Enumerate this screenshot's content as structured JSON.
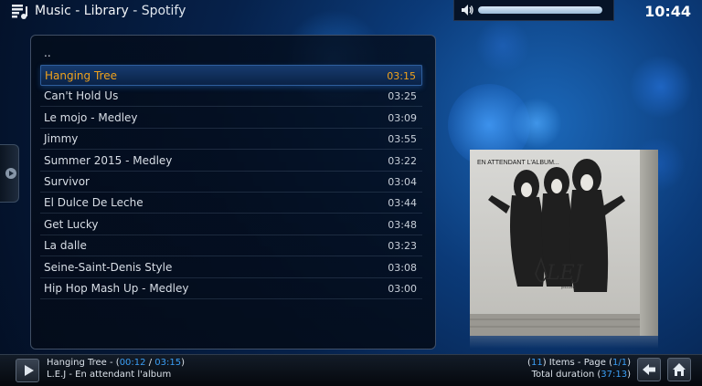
{
  "header": {
    "title": "Music - Library",
    "subtitle": " - Spotify",
    "clock": "10:44",
    "volume_level": 1.0
  },
  "list": {
    "parent_label": "..",
    "items": [
      {
        "name": "Hanging Tree",
        "duration": "03:15",
        "selected": true
      },
      {
        "name": "Can't Hold Us",
        "duration": "03:25"
      },
      {
        "name": "Le mojo - Medley",
        "duration": "03:09"
      },
      {
        "name": "Jimmy",
        "duration": "03:55"
      },
      {
        "name": "Summer 2015 - Medley",
        "duration": "03:22"
      },
      {
        "name": "Survivor",
        "duration": "03:04"
      },
      {
        "name": "El Dulce De Leche",
        "duration": "03:44"
      },
      {
        "name": "Get Lucky",
        "duration": "03:48"
      },
      {
        "name": "La dalle",
        "duration": "03:23"
      },
      {
        "name": "Seine-Saint-Denis Style",
        "duration": "03:08"
      },
      {
        "name": "Hip Hop Mash Up - Medley",
        "duration": "03:00"
      }
    ]
  },
  "album_art": {
    "caption": "EN ATTENDANT L'ALBUM...",
    "logo_text": "LEJ",
    "small_text": "(ELIJAY)"
  },
  "now_playing": {
    "track": "Hanging Tree - ",
    "elapsed": "00:12",
    "separator": " / ",
    "total": "03:15",
    "artist_album": "L.E.J - En attendant l'album"
  },
  "list_info": {
    "items_count": "11",
    "items_label": ") Items - Page (",
    "page": "1/1",
    "page_close": ")",
    "duration_label": "Total duration (",
    "duration": "37:13",
    "duration_close": ")"
  },
  "icons": {
    "app": "music-library-icon",
    "volume": "speaker-icon",
    "play": "play-icon",
    "back": "back-arrow-icon",
    "home": "home-icon",
    "side": "chevron-right-icon"
  },
  "colors": {
    "accent_selected": "#f0a21c",
    "accent_info": "#3a9ef5",
    "background": "#06214a"
  }
}
